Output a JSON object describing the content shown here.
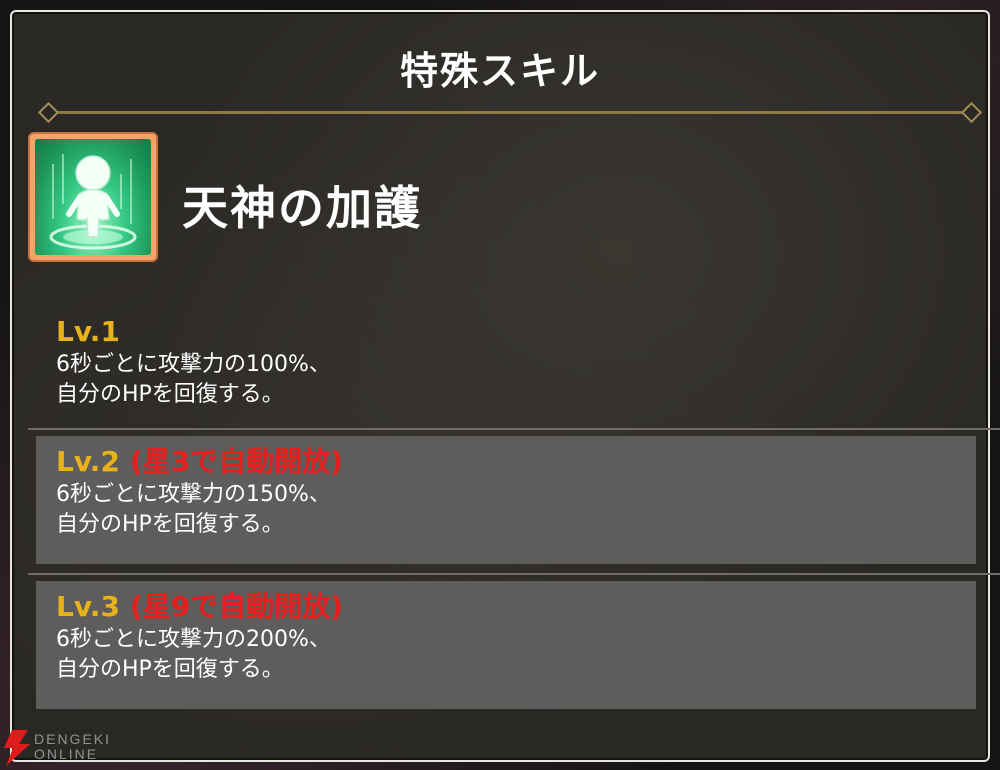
{
  "panel": {
    "title": "特殊スキル"
  },
  "skill": {
    "name": "天神の加護",
    "icon": "green-aura-character-icon"
  },
  "levels": [
    {
      "label": "Lv.1",
      "note": "",
      "desc": "6秒ごとに攻撃力の100%、\n自分のHPを回復する。"
    },
    {
      "label": "Lv.2",
      "note": "(星3で自動開放)",
      "desc": "6秒ごとに攻撃力の150%、\n自分のHPを回復する。"
    },
    {
      "label": "Lv.3",
      "note": "(星9で自動開放)",
      "desc": "6秒ごとに攻撃力の200%、\n自分のHPを回復する。"
    }
  ],
  "watermark": {
    "line1": "DENGEKI",
    "line2": "ONLINE"
  },
  "colors": {
    "level_label": "#e8b21d",
    "unlock_note": "#e51e1e",
    "locked_row_bg": "#5f5d5b",
    "divider": "#8c7a48"
  }
}
